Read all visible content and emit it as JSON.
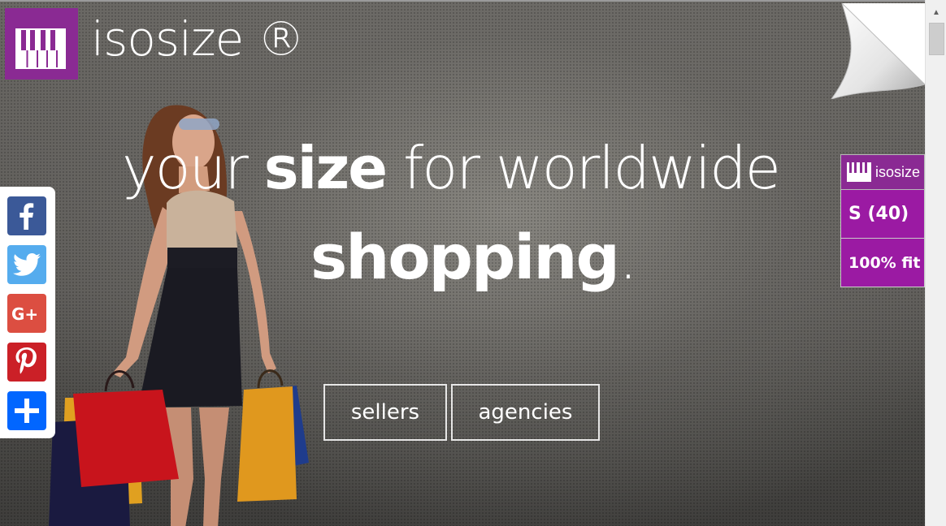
{
  "brand": {
    "name": "isosize ®",
    "color": "#8a2a93"
  },
  "hero": {
    "headline_part1": "your ",
    "headline_bold": "size",
    "headline_part2": " for worldwide",
    "headline_line2": "shopping",
    "headline_period": "."
  },
  "buttons": {
    "sellers": "sellers",
    "agencies": "agencies"
  },
  "social": [
    {
      "name": "facebook",
      "icon": "facebook-icon",
      "color": "#3b5998"
    },
    {
      "name": "twitter",
      "icon": "twitter-icon",
      "color": "#55acee"
    },
    {
      "name": "google-plus",
      "icon": "google-plus-icon",
      "color": "#dc4e41"
    },
    {
      "name": "pinterest",
      "icon": "pinterest-icon",
      "color": "#cb2027"
    },
    {
      "name": "share",
      "icon": "plus-icon",
      "color": "#0166ff"
    }
  ],
  "widget": {
    "brand": "isosize",
    "size": "S (40)",
    "fit": "100% fit"
  }
}
